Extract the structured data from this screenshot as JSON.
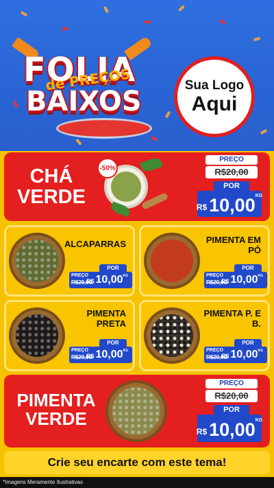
{
  "hero": {
    "title_top": "FOLIA",
    "title_mid": "de PREÇOS",
    "title_bottom": "BAIXOS",
    "logo_line1": "Sua Logo",
    "logo_line2": "Aqui"
  },
  "featured_top": {
    "name_line1": "CHÁ",
    "name_line2": "VERDE",
    "discount_badge": "-50%",
    "price_label": "PREÇO",
    "old_price": "R$20,00",
    "por_label": "POR",
    "currency": "R$",
    "new_price": "10,00",
    "unit": "KG"
  },
  "grid_items": [
    {
      "name": "ALCAPARRAS",
      "price_label": "PREÇO",
      "old_price": "R$20,00",
      "por_label": "POR",
      "currency": "R$",
      "new_price": "10,00",
      "unit": "KG"
    },
    {
      "name": "PIMENTA EM PÓ",
      "price_label": "PREÇO",
      "old_price": "R$20,00",
      "por_label": "POR",
      "currency": "R$",
      "new_price": "10,00",
      "unit": "KG"
    },
    {
      "name": "PIMENTA PRETA",
      "price_label": "PREÇO",
      "old_price": "R$20,00",
      "por_label": "POR",
      "currency": "R$",
      "new_price": "10,00",
      "unit": "KG"
    },
    {
      "name": "PIMENTA P. E B.",
      "price_label": "PREÇO",
      "old_price": "R$20,00",
      "por_label": "POR",
      "currency": "R$",
      "new_price": "10,00",
      "unit": "KG"
    }
  ],
  "featured_bottom": {
    "name_line1": "PIMENTA",
    "name_line2": "VERDE",
    "price_label": "PREÇO",
    "old_price": "R$20,00",
    "por_label": "POR",
    "currency": "R$",
    "new_price": "10,00",
    "unit": "KG"
  },
  "footer": {
    "cta": "Crie seu encarte com este tema!",
    "note": "*Imagens Meramente Ilustrativas"
  },
  "colors": {
    "hero_blue": "#2f6fe0",
    "red": "#e41f1f",
    "yellow": "#f9c400",
    "price_blue": "#2149c9"
  }
}
